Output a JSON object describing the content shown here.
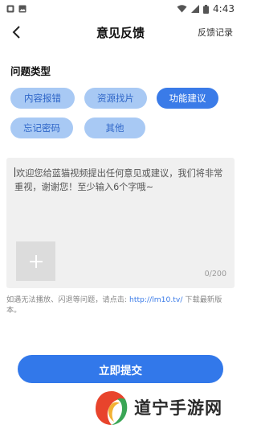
{
  "status_bar": {
    "time": "4:43",
    "icons": [
      "notification-icon",
      "image-icon",
      "wifi-icon",
      "signal-icon",
      "battery-icon"
    ]
  },
  "header": {
    "title": "意见反馈",
    "history": "反馈记录"
  },
  "section": {
    "label": "问题类型"
  },
  "chips": [
    {
      "label": "内容报错",
      "active": false
    },
    {
      "label": "资源找片",
      "active": false
    },
    {
      "label": "功能建议",
      "active": true
    },
    {
      "label": "忘记密码",
      "active": false
    },
    {
      "label": "其他",
      "active": false
    }
  ],
  "feedback": {
    "placeholder": "欢迎您给蓝猫视频提出任何意见或建议，我们将非常重视，谢谢您！至少输入6个字哦~",
    "counter": "0/200"
  },
  "hint": {
    "prefix": "如遇无法播放、闪退等问题，请点击: ",
    "link": "http://lm10.tv/",
    "suffix": " 下载最新版本。"
  },
  "submit_label": "立即提交",
  "watermark": {
    "text": "道宁手游网"
  },
  "colors": {
    "accent": "#3278ea",
    "chip_bg": "#a8c9f4",
    "chip_text": "#2f66c8"
  }
}
